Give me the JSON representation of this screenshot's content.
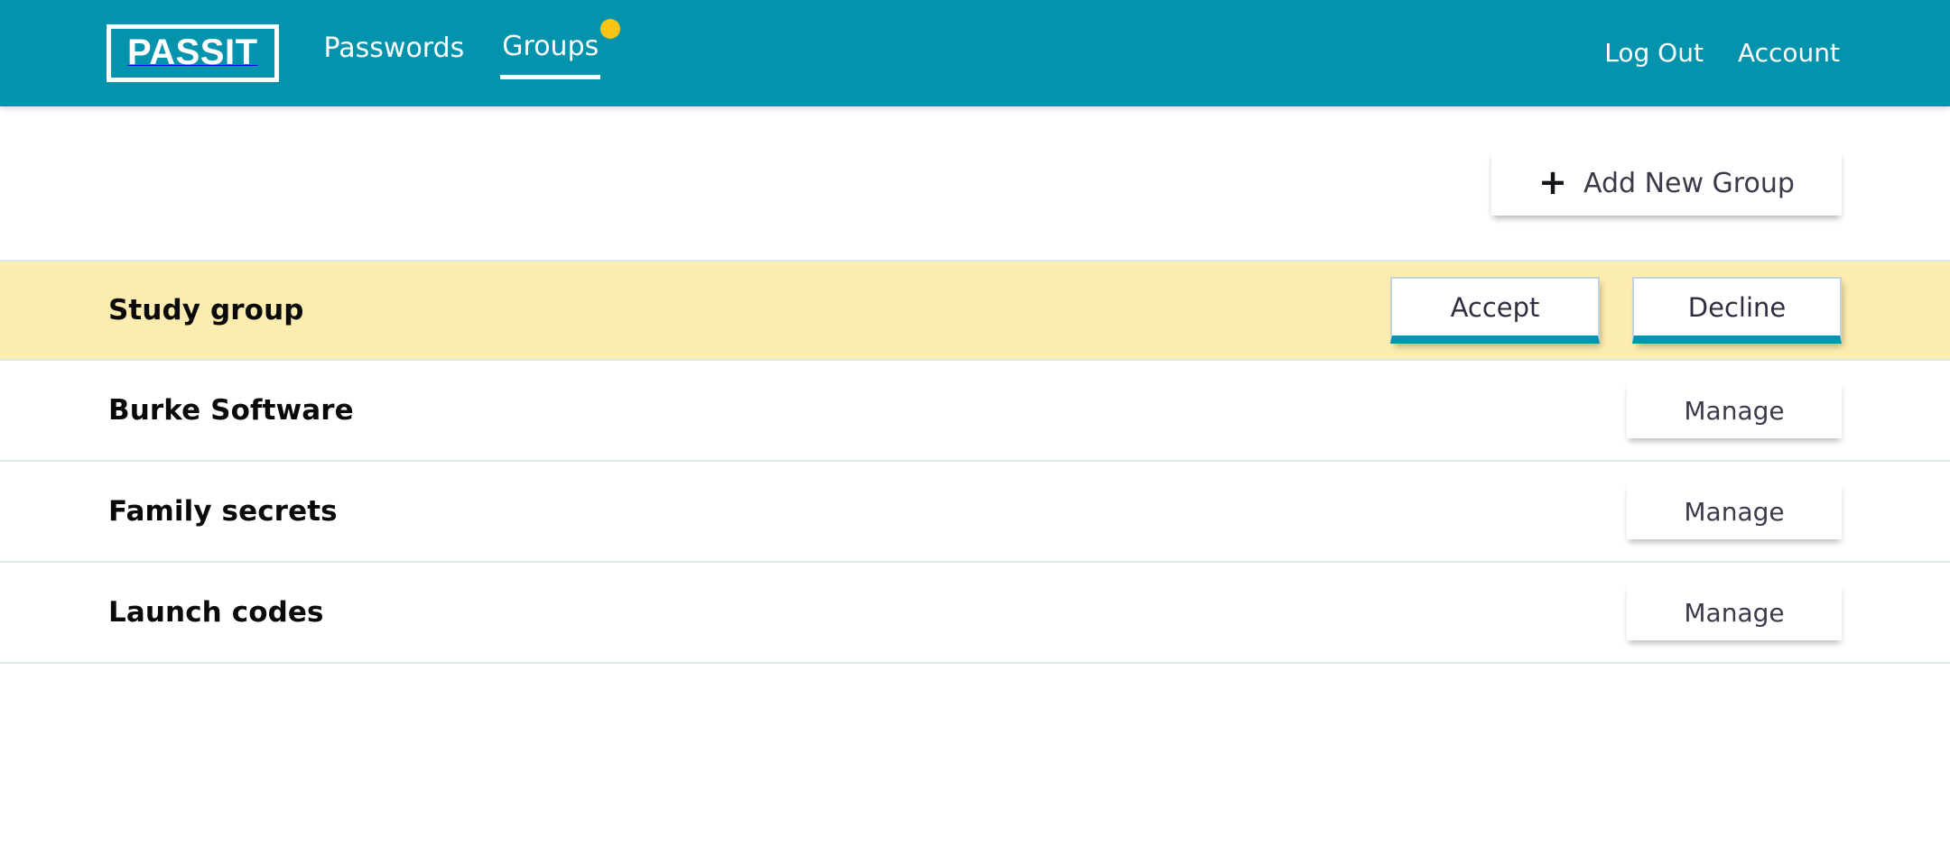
{
  "header": {
    "brand": "PASSIT",
    "nav": [
      {
        "label": "Passwords",
        "active": false,
        "badge": false
      },
      {
        "label": "Groups",
        "active": true,
        "badge": true
      }
    ],
    "account_nav": [
      {
        "label": "Log Out"
      },
      {
        "label": "Account"
      }
    ],
    "badge_color": "#FDC513",
    "background_color": "#0493AD"
  },
  "toolbar": {
    "add_group_label": "Add New Group",
    "add_group_icon": "plus-icon"
  },
  "groups": [
    {
      "name": "Study group",
      "state": "pending-invite",
      "highlight_color": "#FDECB0",
      "actions": [
        {
          "label": "Accept",
          "kind": "invite"
        },
        {
          "label": "Decline",
          "kind": "invite"
        }
      ]
    },
    {
      "name": "Burke Software",
      "state": "member",
      "actions": [
        {
          "label": "Manage",
          "kind": "manage"
        }
      ]
    },
    {
      "name": "Family secrets",
      "state": "member",
      "actions": [
        {
          "label": "Manage",
          "kind": "manage"
        }
      ]
    },
    {
      "name": "Launch codes",
      "state": "member",
      "actions": [
        {
          "label": "Manage",
          "kind": "manage"
        }
      ]
    }
  ]
}
